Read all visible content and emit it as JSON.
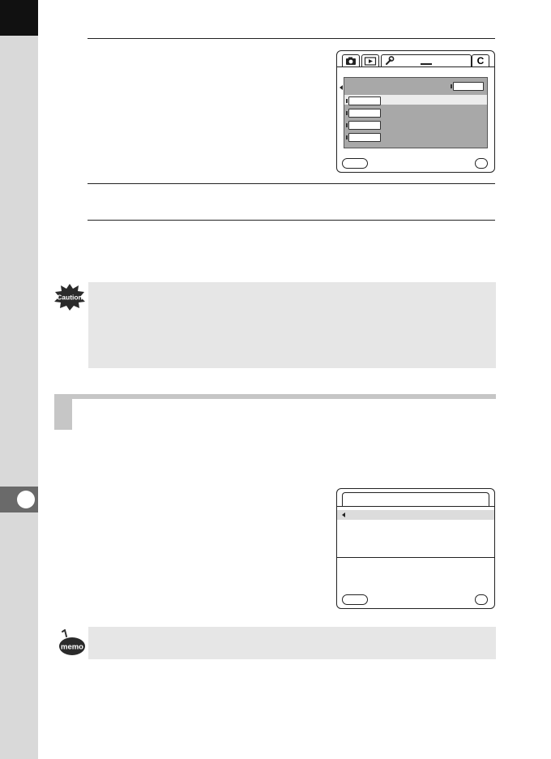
{
  "icons": {
    "caution": "caution-icon",
    "memo": "memo-icon",
    "camera_tab": "camera-icon",
    "playback_tab": "playback-icon",
    "setup_tab": "wrench-icon"
  },
  "screen1": {
    "custom_tab_label": "C"
  },
  "caution_icon_text": "Caution",
  "memo_icon_text": "memo",
  "colors": {
    "sidebar": "#d9d9d9",
    "chapter_tab": "#111111",
    "note_background": "#e6e6e6",
    "section_bar": "#c6c6c6"
  }
}
